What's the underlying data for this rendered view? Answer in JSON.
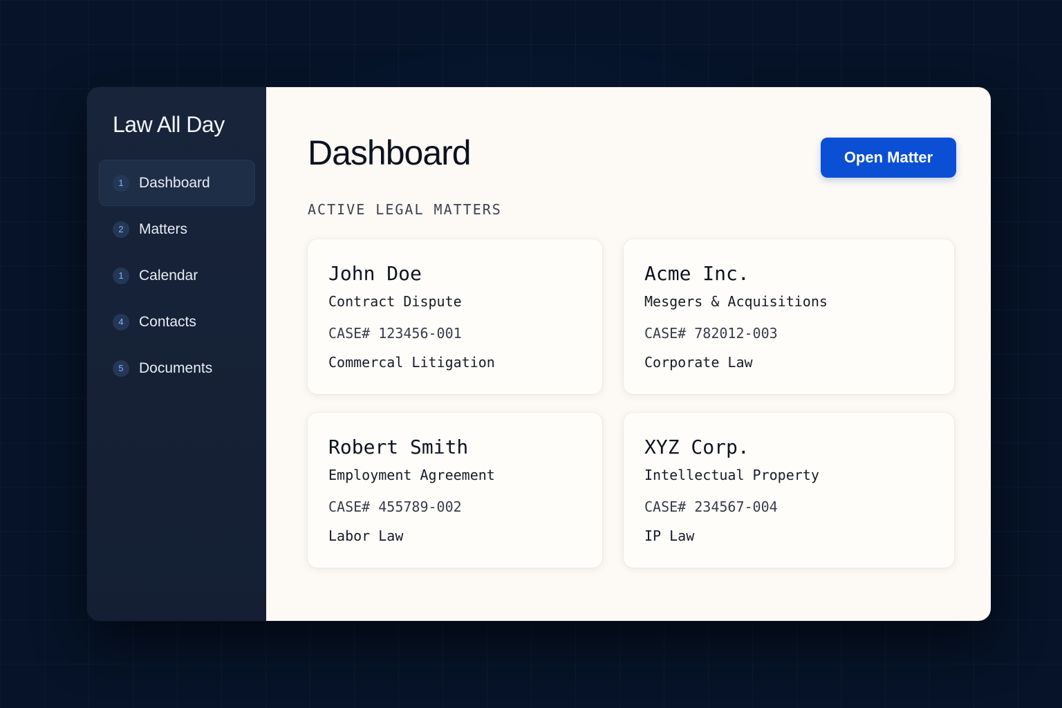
{
  "app": {
    "title": "Law All Day"
  },
  "sidebar": {
    "items": [
      {
        "num": "1",
        "label": "Dashboard",
        "active": true
      },
      {
        "num": "2",
        "label": "Matters"
      },
      {
        "num": "1",
        "label": "Calendar"
      },
      {
        "num": "4",
        "label": "Contacts"
      },
      {
        "num": "5",
        "label": "Documents"
      }
    ]
  },
  "main": {
    "title": "Dashboard",
    "primary_button": "Open Matter",
    "section_label": "ACTIVE LEGAL MATTERS",
    "matters": [
      {
        "client": "John Doe",
        "matter_type": "Contract Dispute",
        "case_number": "CASE# 123456-001",
        "practice_area": "Commercal Litigation"
      },
      {
        "client": "Acme Inc.",
        "matter_type": "Mesgers & Acquisitions",
        "case_number": "CASE# 782012-003",
        "practice_area": "Corporate Law"
      },
      {
        "client": "Robert Smith",
        "matter_type": "Employment Agreement",
        "case_number": "CASE# 455789-002",
        "practice_area": "Labor Law"
      },
      {
        "client": "XYZ Corp.",
        "matter_type": "Intellectual Property",
        "case_number": "CASE# 234567-004",
        "practice_area": "IP Law"
      }
    ]
  },
  "colors": {
    "accent": "#0a4fd4",
    "sidebar_bg": "#16223a",
    "content_bg": "#fdf9f4",
    "backdrop": "#061328"
  }
}
